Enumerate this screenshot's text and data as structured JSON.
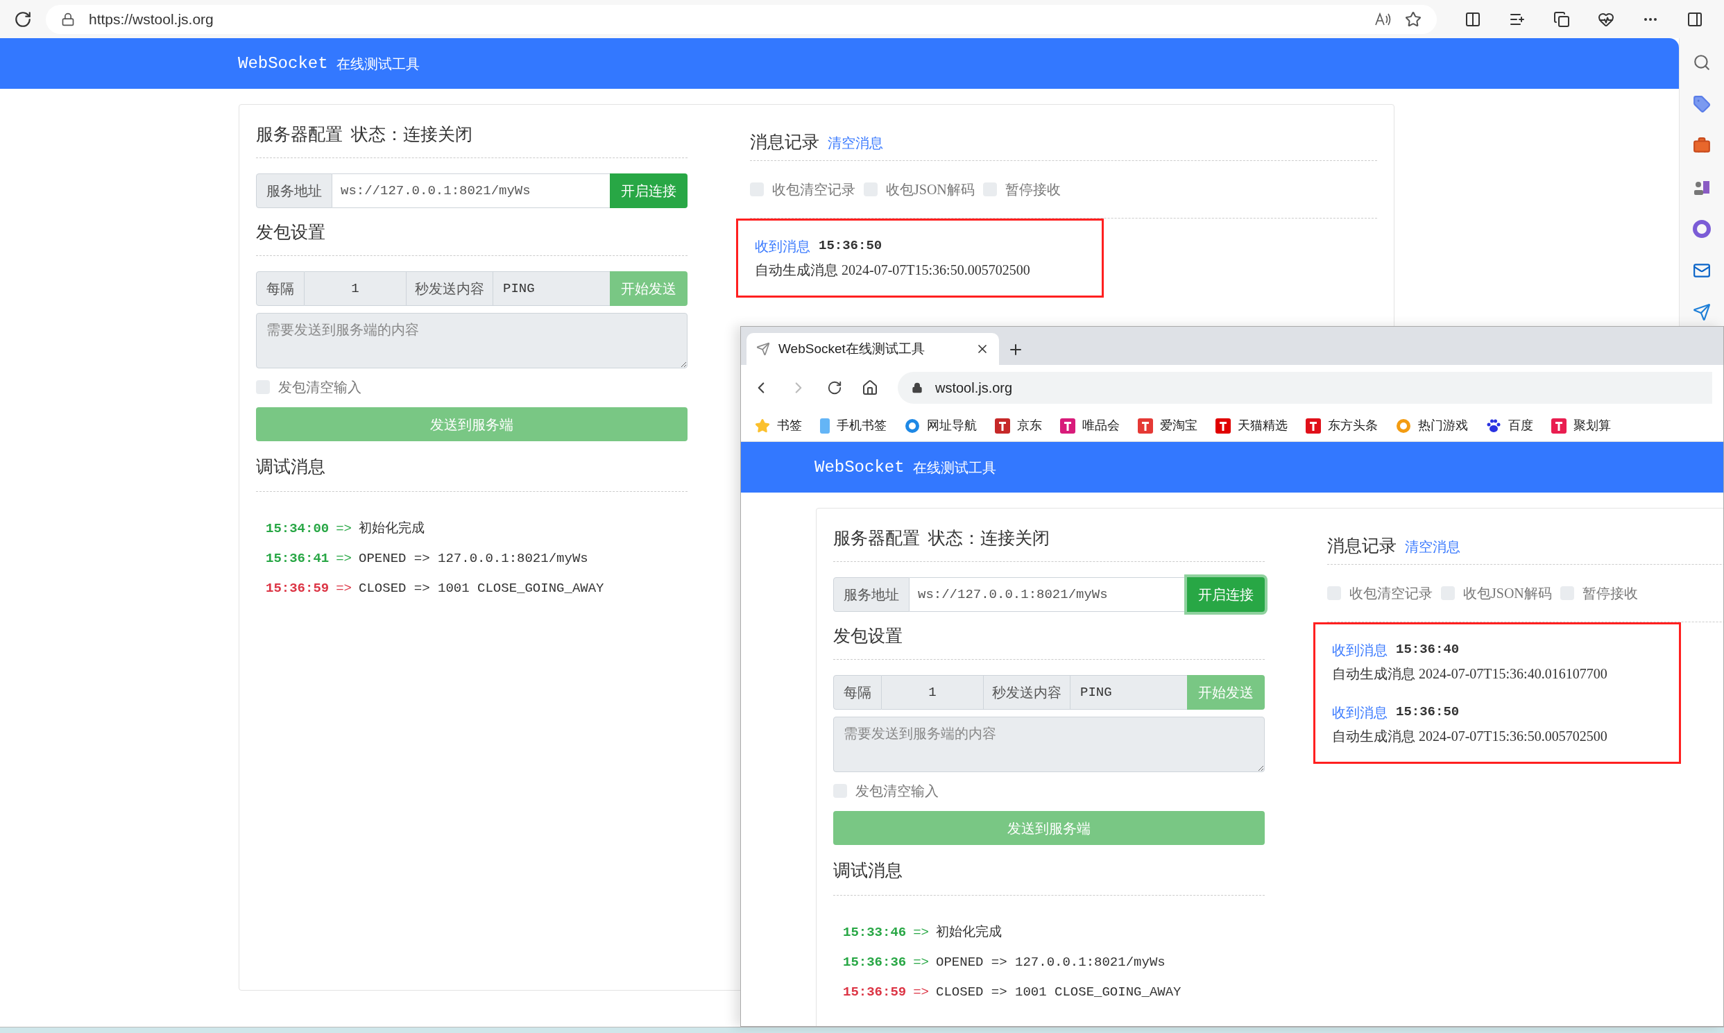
{
  "browser": {
    "url": "https://wstool.js.org"
  },
  "page": {
    "header": {
      "brand": "WebSocket",
      "subtitle": "在线测试工具"
    },
    "server": {
      "title": "服务器配置",
      "status": "状态：连接关闭",
      "address_label": "服务地址",
      "address": "ws://127.0.0.1:8021/myWs",
      "connect_button": {
        "label": "开启连接",
        "disabled": false,
        "focused": false
      }
    },
    "send_settings": {
      "title": "发包设置",
      "every_label": "每隔",
      "interval": "1",
      "content_label": "秒发送内容",
      "content": "PING",
      "start_button": {
        "label": "开始发送",
        "disabled": true
      },
      "message_placeholder": "需要发送到服务端的内容",
      "clear_input": {
        "label": "发包清空输入",
        "checked": false
      },
      "send_button": {
        "label": "发送到服务端",
        "disabled": true
      }
    },
    "debug": {
      "title": "调试消息",
      "entries": [
        {
          "time": "15:34:00",
          "arrow": "=>",
          "text": "初始化完成",
          "color": "#28a745"
        },
        {
          "time": "15:36:41",
          "arrow": "=>",
          "text": "OPENED => 127.0.0.1:8021/myWs",
          "color": "#28a745"
        },
        {
          "time": "15:36:59",
          "arrow": "=>",
          "text": "CLOSED => 1001 CLOSE_GOING_AWAY",
          "color": "#dc3545"
        }
      ]
    },
    "messages": {
      "title": "消息记录",
      "clear_link": "清空消息",
      "options": [
        {
          "label": "收包清空记录",
          "checked": false
        },
        {
          "label": "收包JSON解码",
          "checked": false
        },
        {
          "label": "暂停接收",
          "checked": false
        }
      ],
      "highlighted": true,
      "items": [
        {
          "label": "收到消息",
          "time": "15:36:50",
          "body": "自动生成消息 2024-07-07T15:36:50.005702500"
        }
      ]
    }
  },
  "second_window": {
    "tab_title": "WebSocket在线测试工具",
    "url": "wstool.js.org",
    "bookmarks": [
      {
        "label": "书签",
        "kind": "star",
        "color": "#fbc02d"
      },
      {
        "label": "手机书签",
        "kind": "phone",
        "color": "#64b5f6"
      },
      {
        "label": "网址导航",
        "kind": "circle",
        "color": "#1e88e5"
      },
      {
        "label": "京东",
        "kind": "tile",
        "color": "#c62828"
      },
      {
        "label": "唯品会",
        "kind": "tile",
        "color": "#d81b7a"
      },
      {
        "label": "爱淘宝",
        "kind": "tile",
        "color": "#e53935"
      },
      {
        "label": "天猫精选",
        "kind": "tile",
        "color": "#e00000"
      },
      {
        "label": "东方头条",
        "kind": "tile",
        "color": "#e0101a"
      },
      {
        "label": "热门游戏",
        "kind": "circle",
        "color": "#f39c12"
      },
      {
        "label": "百度",
        "kind": "paw",
        "color": "#2932e1"
      },
      {
        "label": "聚划算",
        "kind": "tile",
        "color": "#e91e50"
      }
    ],
    "page": {
      "header": {
        "brand": "WebSocket",
        "subtitle": "在线测试工具"
      },
      "server": {
        "title": "服务器配置",
        "status": "状态：连接关闭",
        "address_label": "服务地址",
        "address": "ws://127.0.0.1:8021/myWs",
        "connect_button": {
          "label": "开启连接",
          "disabled": false,
          "focused": true
        }
      },
      "send_settings": {
        "title": "发包设置",
        "every_label": "每隔",
        "interval": "1",
        "content_label": "秒发送内容",
        "content": "PING",
        "start_button": {
          "label": "开始发送",
          "disabled": true
        },
        "message_placeholder": "需要发送到服务端的内容",
        "clear_input": {
          "label": "发包清空输入",
          "checked": false
        },
        "send_button": {
          "label": "发送到服务端",
          "disabled": true
        }
      },
      "debug": {
        "title": "调试消息",
        "entries": [
          {
            "time": "15:33:46",
            "arrow": "=>",
            "text": "初始化完成",
            "color": "#28a745"
          },
          {
            "time": "15:36:36",
            "arrow": "=>",
            "text": "OPENED => 127.0.0.1:8021/myWs",
            "color": "#28a745"
          },
          {
            "time": "15:36:59",
            "arrow": "=>",
            "text": "CLOSED => 1001 CLOSE_GOING_AWAY",
            "color": "#dc3545"
          }
        ]
      },
      "messages": {
        "title": "消息记录",
        "clear_link": "清空消息",
        "options": [
          {
            "label": "收包清空记录",
            "checked": false
          },
          {
            "label": "收包JSON解码",
            "checked": false
          },
          {
            "label": "暂停接收",
            "checked": false
          }
        ],
        "highlighted": true,
        "items": [
          {
            "label": "收到消息",
            "time": "15:36:40",
            "body": "自动生成消息 2024-07-07T15:36:40.016107700"
          },
          {
            "label": "收到消息",
            "time": "15:36:50",
            "body": "自动生成消息 2024-07-07T15:36:50.005702500"
          }
        ]
      }
    }
  }
}
